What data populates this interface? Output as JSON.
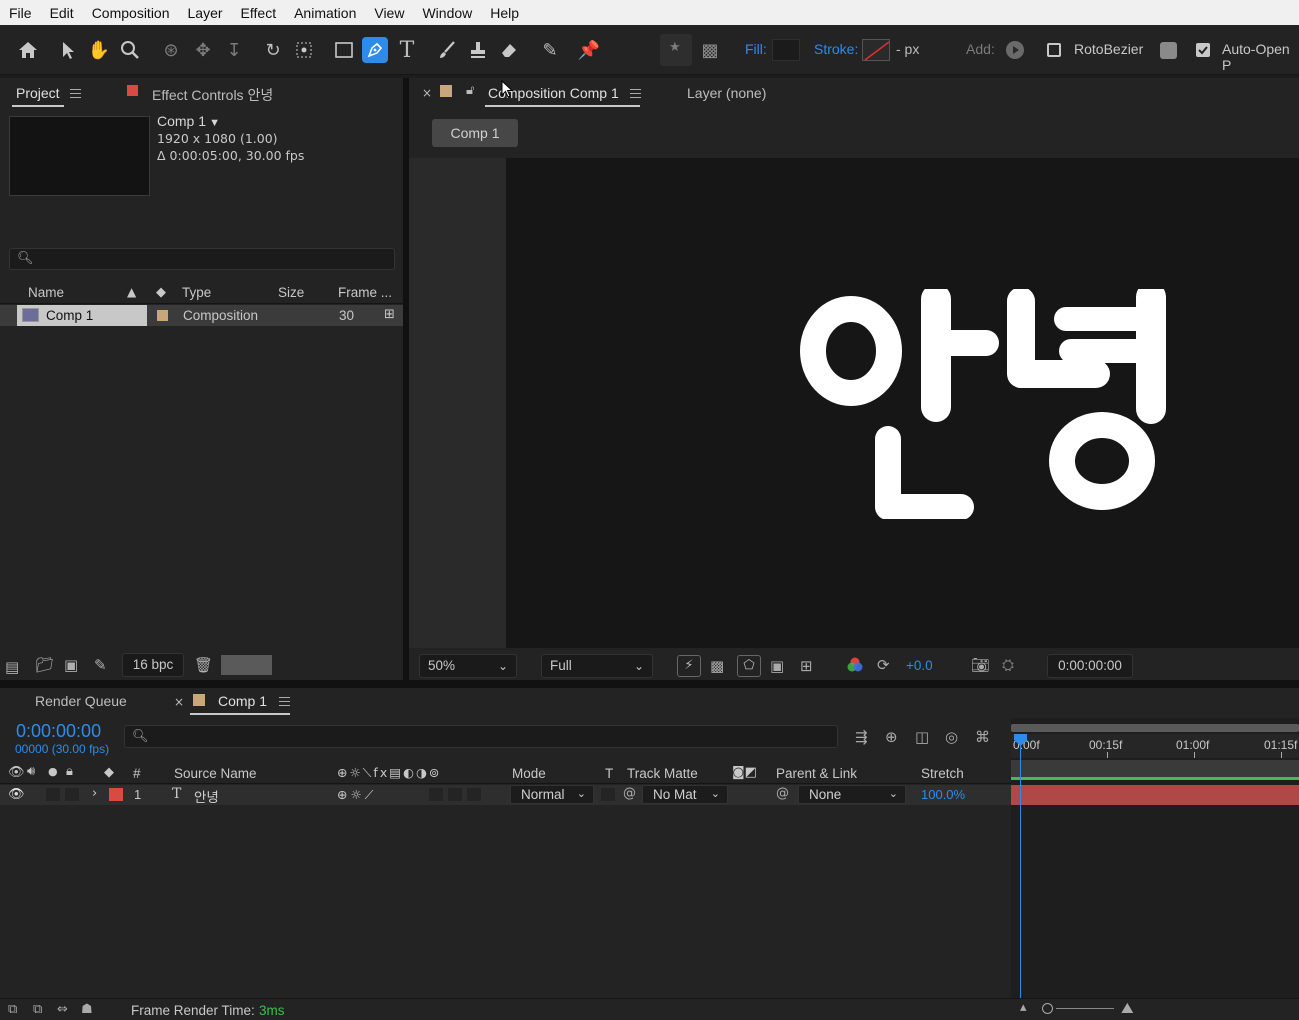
{
  "menu": [
    "File",
    "Edit",
    "Composition",
    "Layer",
    "Effect",
    "Animation",
    "View",
    "Window",
    "Help"
  ],
  "toolbar": {
    "fill_label": "Fill:",
    "stroke_label": "Stroke:",
    "stroke_unit": "- px",
    "add_label": "Add:",
    "rotobezier_label": "RotoBezier",
    "auto_open_label": "Auto-Open P"
  },
  "project_panel": {
    "tab_project": "Project",
    "tab_effect_controls": "Effect Controls 안녕",
    "comp_name": "Comp 1",
    "comp_resolution": "1920 x 1080 (1.00)",
    "comp_duration": "Δ 0:00:05:00, 30.00 fps",
    "columns": [
      "Name",
      "Type",
      "Size",
      "Frame ..."
    ],
    "row": {
      "name": "Comp 1",
      "type": "Composition",
      "frame": "30"
    },
    "bpc": "16 bpc"
  },
  "comp_panel": {
    "tab_title": "Composition Comp 1",
    "layer_tab": "Layer (none)",
    "breadcrumb": "Comp 1",
    "canvas_text_top": "안녕",
    "zoom": "50%",
    "resolution": "Full",
    "exposure": "+0.0",
    "timecode": "0:00:00:00"
  },
  "timeline": {
    "tab_render_queue": "Render Queue",
    "tab_comp": "Comp 1",
    "current_time": "0:00:00:00",
    "frame_info": "00000 (30.00 fps)",
    "ruler": [
      "0:00f",
      "00:15f",
      "01:00f",
      "01:15f"
    ],
    "columns": {
      "num": "#",
      "source": "Source Name",
      "mode": "Mode",
      "t": "T",
      "track_matte": "Track Matte",
      "parent": "Parent & Link",
      "stretch": "Stretch"
    },
    "layer": {
      "index": "1",
      "name": "안녕",
      "mode": "Normal",
      "matte": "No Mat",
      "parent": "None",
      "stretch": "100.0%"
    },
    "footer_label": "Frame Render Time:",
    "footer_value": "3ms"
  },
  "colors": {
    "accent_blue": "#2d8ceb",
    "label_red": "#d94a42",
    "label_tan": "#c7a77b",
    "layer_bar": "#b04848",
    "work_area_green": "#3fbf4f"
  }
}
